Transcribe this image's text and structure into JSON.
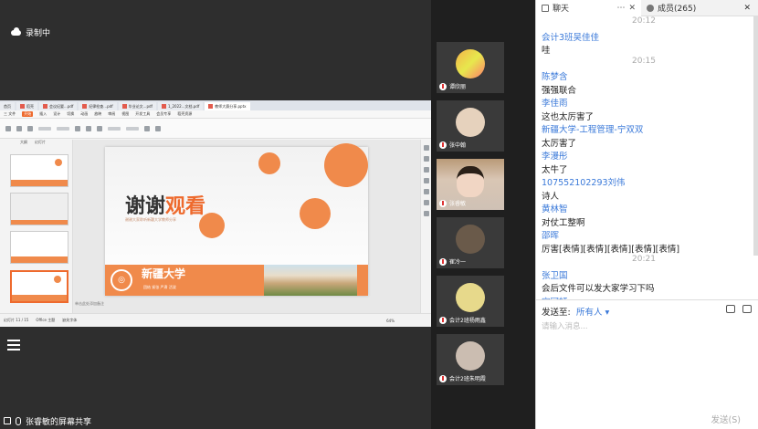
{
  "recording": {
    "label": "录制中"
  },
  "ppt": {
    "tabs": [
      "首页",
      "稻壳",
      "会议纪要...pdf",
      "纪律检查...pdf",
      "毕业论文...pdf",
      "1_2022...文档.pdf",
      "教师大赛分享.pptx"
    ],
    "menu": [
      "三 文件",
      "开始",
      "插入",
      "设计",
      "切换",
      "动画",
      "放映",
      "审阅",
      "视图",
      "开发工具",
      "会员专享",
      "稻壳资源"
    ],
    "thumb_tabs": [
      "大纲",
      "幻灯片"
    ],
    "slide": {
      "title_dark": "谢谢",
      "title_orange": "观看",
      "subtitle": "谢谢大家聆听新疆大学教师分享",
      "university": "新疆大学",
      "motto": "团结 紧张 严肃 活泼"
    },
    "notes": "单击此处添加备注",
    "status": {
      "page": "幻灯片 11 / 15",
      "theme": "Office 主题",
      "lost_font": "缺失字体",
      "zoom": "64%"
    }
  },
  "bottom": {
    "share_label": "张睿敏的屏幕共享"
  },
  "participants": [
    {
      "name": "谭欣丽",
      "avatar": "bg1"
    },
    {
      "name": "张中翰",
      "avatar": "bg2"
    },
    {
      "name": "张睿敏",
      "avatar": "video"
    },
    {
      "name": "崔冷一",
      "avatar": "bg3"
    },
    {
      "name": "会计2班杨雨鑫",
      "avatar": "bg4"
    },
    {
      "name": "会计2班朱明霞",
      "avatar": "bg5"
    }
  ],
  "chat": {
    "tab_label": "聊天",
    "members_label": "成员(265)",
    "messages": [
      {
        "kind": "time",
        "text": "20:12"
      },
      {
        "kind": "name",
        "text": "会计3班吴佳佳"
      },
      {
        "kind": "text",
        "text": "哇"
      },
      {
        "kind": "time",
        "text": "20:15"
      },
      {
        "kind": "name",
        "text": "陈梦含"
      },
      {
        "kind": "text",
        "text": "强强联合"
      },
      {
        "kind": "name",
        "text": "李佳雨"
      },
      {
        "kind": "text",
        "text": "这也太厉害了"
      },
      {
        "kind": "name",
        "text": "新疆大学-工程管理-宁双双"
      },
      {
        "kind": "text",
        "text": "太厉害了"
      },
      {
        "kind": "name",
        "text": "李漫彤"
      },
      {
        "kind": "text",
        "text": "太牛了"
      },
      {
        "kind": "name",
        "text": "107552102293刘伟"
      },
      {
        "kind": "text",
        "text": "诗人"
      },
      {
        "kind": "name",
        "text": "黄林智"
      },
      {
        "kind": "text",
        "text": "对仗工整啊"
      },
      {
        "kind": "name",
        "text": "邵晖"
      },
      {
        "kind": "text",
        "text": "厉害[表情][表情][表情][表情][表情]"
      },
      {
        "kind": "time",
        "text": "20:21"
      },
      {
        "kind": "name",
        "text": "张卫国"
      },
      {
        "kind": "text",
        "text": "会后文件可以发大家学习下吗"
      },
      {
        "kind": "name",
        "text": "宋冠轩"
      }
    ],
    "send_to_label": "发送至:",
    "send_to_value": "所有人 ▾",
    "input_placeholder": "请输入消息...",
    "send_label": "发送(S)"
  },
  "colors": {
    "accent": "#ee6a2d",
    "chat_name": "#3a79d9"
  }
}
